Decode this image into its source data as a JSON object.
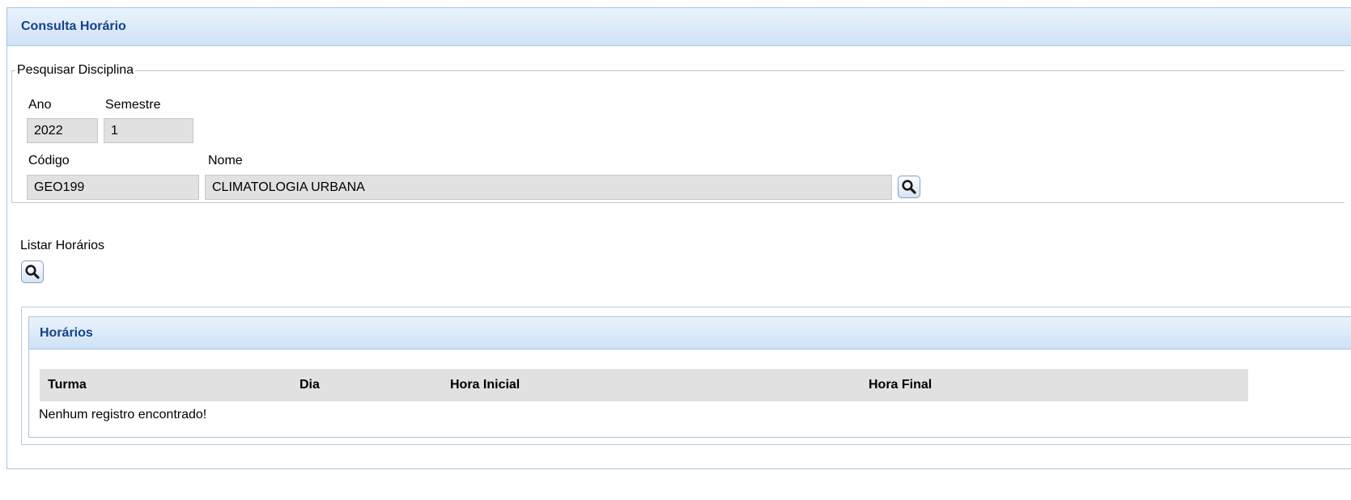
{
  "panel": {
    "title": "Consulta Horário"
  },
  "search": {
    "legend": "Pesquisar Disciplina",
    "ano_label": "Ano",
    "ano_value": "2022",
    "semestre_label": "Semestre",
    "semestre_value": "1",
    "codigo_label": "Código",
    "codigo_value": "GEO199",
    "nome_label": "Nome",
    "nome_value": "CLIMATOLOGIA URBANA",
    "search_icon": "magnifier-icon"
  },
  "listar": {
    "label": "Listar Horários",
    "icon": "magnifier-icon"
  },
  "results": {
    "title": "Horários",
    "columns": [
      "Turma",
      "Dia",
      "Hora Inicial",
      "Hora Final"
    ],
    "empty_message": "Nenhum registro encontrado!"
  },
  "colors": {
    "header_text": "#15428b",
    "header_gradient_top": "#eaf3fc",
    "header_gradient_bottom": "#cfe2f6",
    "input_bg": "#e1e1e1"
  }
}
